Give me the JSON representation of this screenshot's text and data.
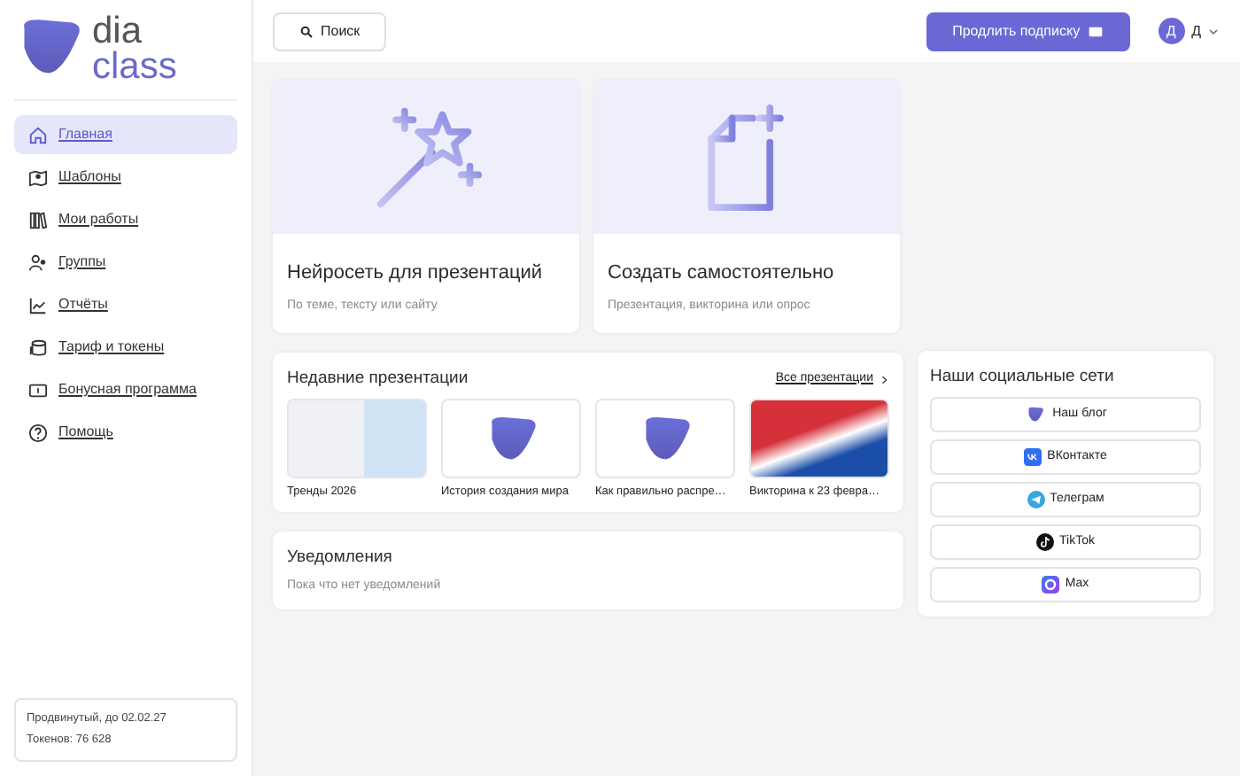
{
  "logo": {
    "line1": "dia",
    "line2": "class"
  },
  "sidebar": {
    "items": [
      {
        "label": "Главная",
        "selected": true
      },
      {
        "label": "Шаблоны",
        "selected": false
      },
      {
        "label": "Мои работы",
        "selected": false
      },
      {
        "label": "Группы",
        "selected": false
      },
      {
        "label": "Отчёты",
        "selected": false
      },
      {
        "label": "Тариф и токены",
        "selected": false
      },
      {
        "label": "Бонусная программа",
        "selected": false
      },
      {
        "label": "Помощь",
        "selected": false
      }
    ],
    "footer": {
      "plan": "Продвинутый, до 02.02.27",
      "tokens": "Токенов: 76 628"
    }
  },
  "header": {
    "search_button": "Поиск",
    "subscribe_button": "Продлить подписку",
    "user": {
      "avatar": "Д",
      "name": "Д"
    }
  },
  "action_cards": [
    {
      "title": "Нейросеть для презентаций",
      "subtitle": "По теме, тексту или сайту"
    },
    {
      "title": "Создать самостоятельно",
      "subtitle": "Презентация, викторина или опрос"
    }
  ],
  "recent": {
    "title": "Недавние презентации",
    "all_link": "Все презентации",
    "items": [
      {
        "title": "Тренды 2026",
        "kind": "image"
      },
      {
        "title": "История создания мира",
        "kind": "logo"
      },
      {
        "title": "Как правильно распре…",
        "kind": "logo"
      },
      {
        "title": "Викторина к 23 февра…",
        "kind": "image"
      }
    ]
  },
  "notifications": {
    "title": "Уведомления",
    "message": "Пока что нет уведомлений"
  },
  "social": {
    "title": "Наши социальные сети",
    "links": [
      {
        "label": "Наш блог"
      },
      {
        "label": "ВКонтакте"
      },
      {
        "label": "Телеграм"
      },
      {
        "label": "TikTok"
      },
      {
        "label": "Max"
      }
    ]
  }
}
